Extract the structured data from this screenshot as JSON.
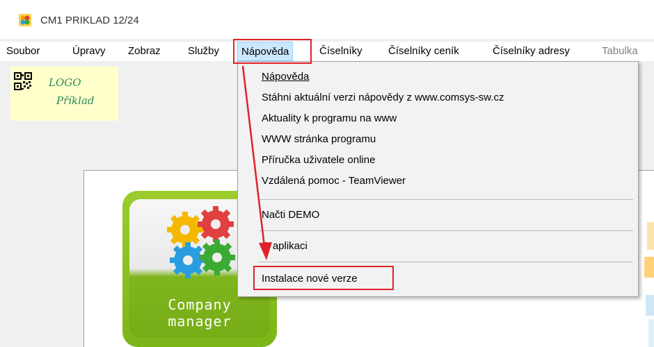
{
  "window": {
    "title": "CM1 PRIKLAD 12/24"
  },
  "menubar": {
    "items": [
      {
        "label": "Soubor",
        "key": "soubor"
      },
      {
        "label": "Úpravy",
        "key": "upravy"
      },
      {
        "label": "Zobraz",
        "key": "zobraz"
      },
      {
        "label": "Služby",
        "key": "sluzby"
      },
      {
        "label": "Nápověda",
        "key": "napoveda",
        "active": true
      },
      {
        "label": "Číselníky",
        "key": "ciselniky"
      },
      {
        "label": "Číselníky ceník",
        "key": "ciselniky-cenik"
      },
      {
        "label": "Číselníky adresy",
        "key": "ciselniky-adresy"
      },
      {
        "label": "Tabulka",
        "key": "tabulka",
        "disabled": true
      }
    ]
  },
  "logo": {
    "line1": "LOGO",
    "line2": "Příklad"
  },
  "dropdown": {
    "group1": [
      "Nápověda",
      "Stáhni aktuální verzi nápovědy z www.comsys-sw.cz",
      "Aktuality k programu na www",
      "WWW stránka programu",
      "Příručka uživatele online",
      "Vzdálená pomoc - TeamViewer"
    ],
    "group2": [
      "Načti DEMO"
    ],
    "group3": [
      "O aplikaci"
    ],
    "group4": [
      "Instalace nové verze"
    ]
  },
  "tile": {
    "line1": "Company",
    "line2": "manager"
  },
  "colors": {
    "annotation": "#e0212b",
    "menu_active": "#cce8ff",
    "tile_green": "#7cb518"
  }
}
